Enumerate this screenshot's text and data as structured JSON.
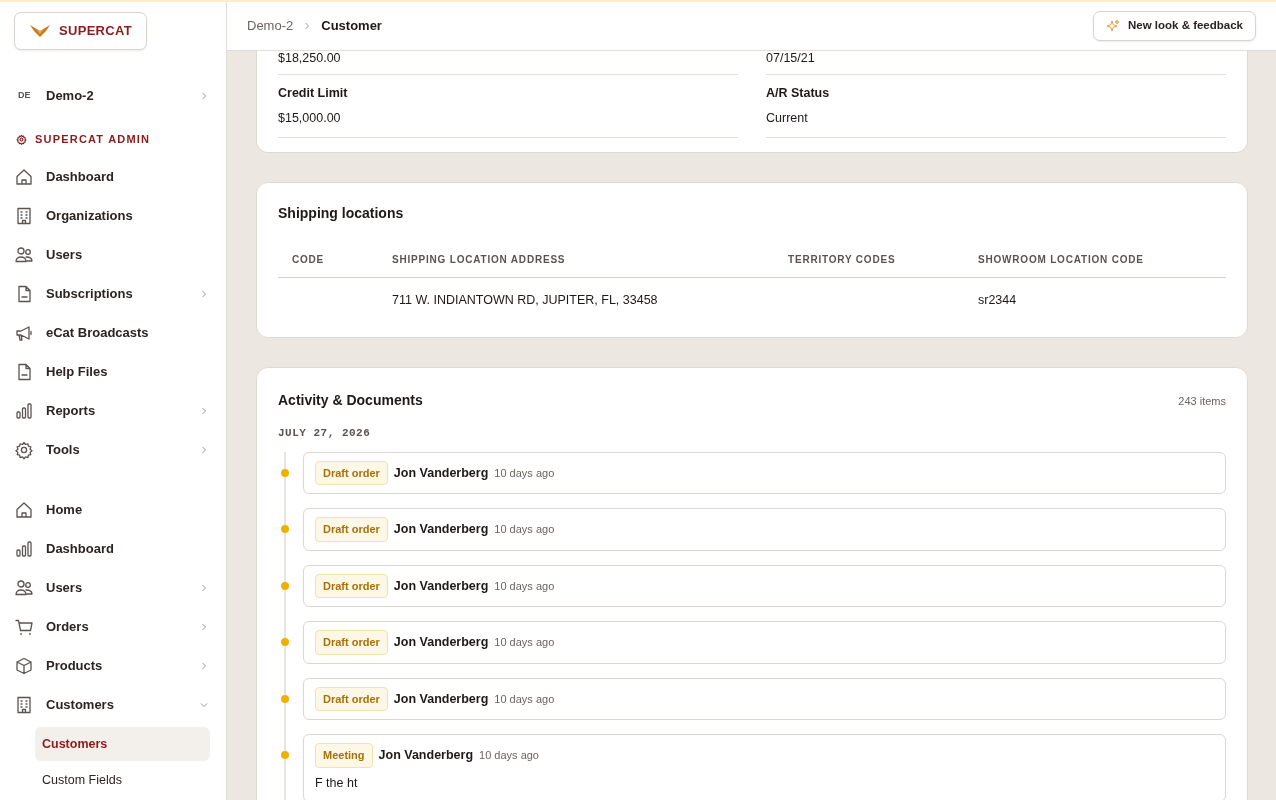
{
  "logo": {
    "text": "SUPERCAT"
  },
  "org": {
    "badge": "DE",
    "label": "Demo-2"
  },
  "admin_section": {
    "title": "SUPERCAT ADMIN",
    "items": [
      {
        "label": "Dashboard",
        "kind": "link"
      },
      {
        "label": "Organizations",
        "kind": "link"
      },
      {
        "label": "Users",
        "kind": "link"
      },
      {
        "label": "Subscriptions",
        "kind": "group",
        "expanded": false
      },
      {
        "label": "eCat Broadcasts",
        "kind": "link"
      },
      {
        "label": "Help Files",
        "kind": "link"
      },
      {
        "label": "Reports",
        "kind": "group",
        "expanded": false
      },
      {
        "label": "Tools",
        "kind": "group",
        "expanded": false
      }
    ]
  },
  "main_nav": {
    "items": [
      {
        "label": "Home",
        "kind": "link"
      },
      {
        "label": "Dashboard",
        "kind": "link"
      },
      {
        "label": "Users",
        "kind": "group",
        "expanded": false
      },
      {
        "label": "Orders",
        "kind": "group",
        "expanded": false
      },
      {
        "label": "Products",
        "kind": "group",
        "expanded": false
      },
      {
        "label": "Customers",
        "kind": "group",
        "expanded": true,
        "children": [
          {
            "label": "Customers",
            "selected": true
          },
          {
            "label": "Custom Fields",
            "selected": false
          }
        ]
      }
    ]
  },
  "breadcrumb": [
    {
      "label": "Demo-2"
    },
    {
      "label": "Customer"
    }
  ],
  "feedback_button": {
    "label": "New look & feedback"
  },
  "summary": {
    "partial_values": [
      "$18,250.00",
      "07/15/21"
    ],
    "fields": [
      {
        "label": "Credit Limit",
        "value": "$15,000.00"
      },
      {
        "label": "A/R Status",
        "value": "Current"
      }
    ]
  },
  "shipping": {
    "title": "Shipping locations",
    "columns": [
      "CODE",
      "SHIPPING LOCATION ADDRESS",
      "TERRITORY CODES",
      "SHOWROOM LOCATION CODE"
    ],
    "rows": [
      [
        "",
        "711 W. INDIANTOWN RD, JUPITER, FL, 33458",
        "",
        "sr2344"
      ]
    ]
  },
  "activity": {
    "title": "Activity & Documents",
    "count": "243 items",
    "date": "JULY 27, 2026",
    "entries": [
      {
        "tag": "Draft order",
        "author": "Jon Vanderberg",
        "time": "10 days ago"
      },
      {
        "tag": "Draft order",
        "author": "Jon Vanderberg",
        "time": "10 days ago"
      },
      {
        "tag": "Draft order",
        "author": "Jon Vanderberg",
        "time": "10 days ago"
      },
      {
        "tag": "Draft order",
        "author": "Jon Vanderberg",
        "time": "10 days ago"
      },
      {
        "tag": "Draft order",
        "author": "Jon Vanderberg",
        "time": "10 days ago"
      },
      {
        "tag": "Meeting",
        "author": "Jon Vanderberg",
        "time": "10 days ago",
        "note": "F the ht"
      }
    ]
  }
}
